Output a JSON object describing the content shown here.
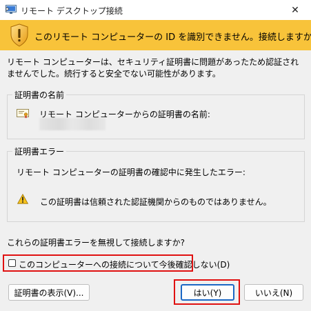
{
  "window": {
    "title": "リモート デスクトップ接続",
    "close_glyph": "✕"
  },
  "banner": {
    "text": "このリモート コンピューターの ID を識別できません。接続しますか?",
    "color": "#f8c33a"
  },
  "description": "リモート コンピューターは、セキュリティ証明書に問題があったため認証されませんでした。続行すると安全でない可能性があります。",
  "cert_name_group": {
    "title": "証明書の名前",
    "label": "リモート コンピューターからの証明書の名前:"
  },
  "cert_error_group": {
    "title": "証明書エラー",
    "label": "リモート コンピューターの証明書の確認中に発生したエラー:",
    "warning": "この証明書は信頼された認証機関からのものではありません。"
  },
  "question": "これらの証明書エラーを無視して接続しますか?",
  "dont_ask_checkbox": {
    "label": "このコンピューターへの接続について今後確認しない(D)",
    "checked": false
  },
  "buttons": {
    "view_cert": "証明書の表示(V)...",
    "yes": "はい(Y)",
    "no": "いいえ(N)"
  },
  "highlight_color": "#e01010"
}
